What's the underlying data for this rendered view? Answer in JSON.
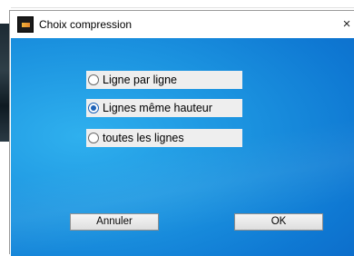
{
  "dialog": {
    "title": "Choix compression",
    "close_label": "×"
  },
  "options": [
    {
      "label": "Ligne par ligne",
      "checked": false
    },
    {
      "label": "Lignes même hauteur",
      "checked": true
    },
    {
      "label": "toutes les lignes",
      "checked": false
    }
  ],
  "buttons": {
    "cancel_label": "Annuler",
    "ok_label": "OK"
  },
  "colors": {
    "accent": "#1f63b8",
    "panel_background": "#1b92df"
  }
}
